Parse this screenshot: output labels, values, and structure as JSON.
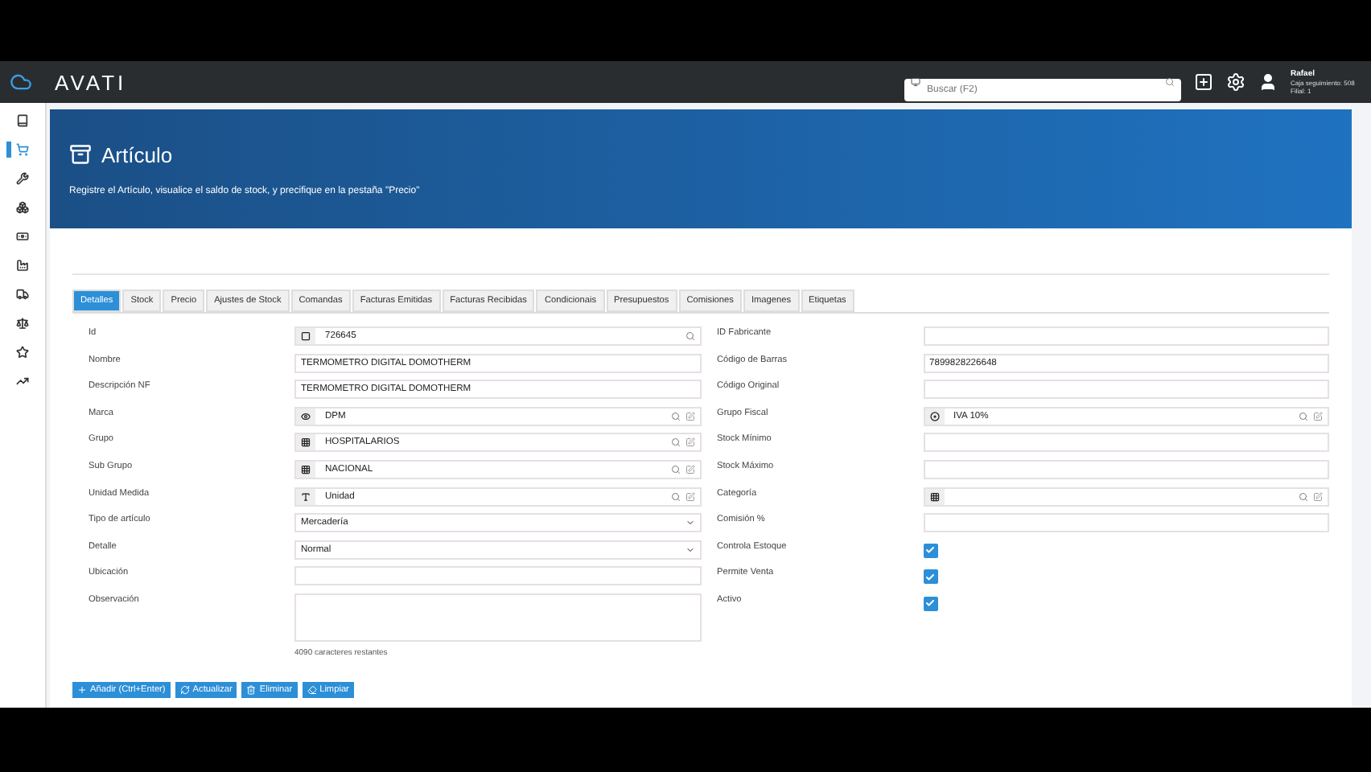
{
  "topbar": {
    "brand": "AVATI",
    "search": {
      "placeholder": "Buscar (F2)"
    },
    "user": {
      "name": "Rafael",
      "line_1": "Caja seguimiento: 508",
      "line_2": "Filial: 1"
    }
  },
  "sidebar": {
    "items": [
      {
        "selected": false
      },
      {
        "selected": true
      },
      {
        "selected": false
      },
      {
        "selected": false
      },
      {
        "selected": false
      },
      {
        "selected": false
      },
      {
        "selected": false
      },
      {
        "selected": false
      },
      {
        "selected": false
      },
      {
        "selected": false
      }
    ]
  },
  "header": {
    "title": "Artículo",
    "subtitle": "Registre el Artículo, visualice el saldo de stock, y precifique en la pestaña \"Precio\""
  },
  "tabs": [
    {
      "label": "Detalles",
      "selected": true
    },
    {
      "label": "Stock",
      "selected": false
    },
    {
      "label": "Precio",
      "selected": false
    },
    {
      "label": "Ajustes de Stock",
      "selected": false
    },
    {
      "label": "Comandas",
      "selected": false
    },
    {
      "label": "Facturas Emitidas",
      "selected": false
    },
    {
      "label": "Facturas Recibidas",
      "selected": false
    },
    {
      "label": "Condicionais",
      "selected": false
    },
    {
      "label": "Presupuestos",
      "selected": false
    },
    {
      "label": "Comisiones",
      "selected": false
    },
    {
      "label": "Imagenes",
      "selected": false
    },
    {
      "label": "Etiquetas",
      "selected": false
    }
  ],
  "left_fields": [
    {
      "label": "Id",
      "kind": "search",
      "value": "726645"
    },
    {
      "label": "Nombre",
      "kind": "text",
      "value": "TERMOMETRO DIGITAL DOMOTHERM"
    },
    {
      "label": "Descripción NF",
      "kind": "text",
      "value": "TERMOMETRO DIGITAL DOMOTHERM"
    },
    {
      "label": "Marca",
      "kind": "lookup",
      "value": "DPM"
    },
    {
      "label": "Grupo",
      "kind": "lookup",
      "value": "HOSPITALARIOS"
    },
    {
      "label": "Sub Grupo",
      "kind": "lookup",
      "value": "NACIONAL"
    },
    {
      "label": "Unidad Medida",
      "kind": "lookup",
      "value": "Unidad"
    },
    {
      "label": "Tipo de artículo",
      "kind": "select",
      "value": "Mercadería"
    },
    {
      "label": "Detalle",
      "kind": "select",
      "value": "Normal"
    },
    {
      "label": "Ubicación",
      "kind": "text"
    },
    {
      "label": "Observación",
      "kind": "textarea",
      "hint": "4090 caracteres restantes"
    }
  ],
  "right_fields": [
    {
      "label": "ID Fabricante",
      "kind": "text"
    },
    {
      "label": "Código de Barras",
      "kind": "text",
      "value": "7899828226648"
    },
    {
      "label": "Código Original",
      "kind": "text"
    },
    {
      "label": "Grupo Fiscal",
      "kind": "lookup",
      "value": "IVA 10%"
    },
    {
      "label": "Stock Mínimo",
      "kind": "text"
    },
    {
      "label": "Stock Máximo",
      "kind": "text"
    },
    {
      "label": "Categoría",
      "kind": "lookup"
    },
    {
      "label": "Comisión %",
      "kind": "text"
    },
    {
      "label": "Controla Estoque",
      "kind": "checkbox",
      "checked": true
    },
    {
      "label": "Permite Venta",
      "kind": "checkbox",
      "checked": true
    },
    {
      "label": "Activo",
      "kind": "checkbox",
      "checked": true
    }
  ],
  "buttons": [
    {
      "label": "Añadir (Ctrl+Enter)"
    },
    {
      "label": "Actualizar"
    },
    {
      "label": "Eliminar"
    },
    {
      "label": "Limpiar"
    }
  ]
}
